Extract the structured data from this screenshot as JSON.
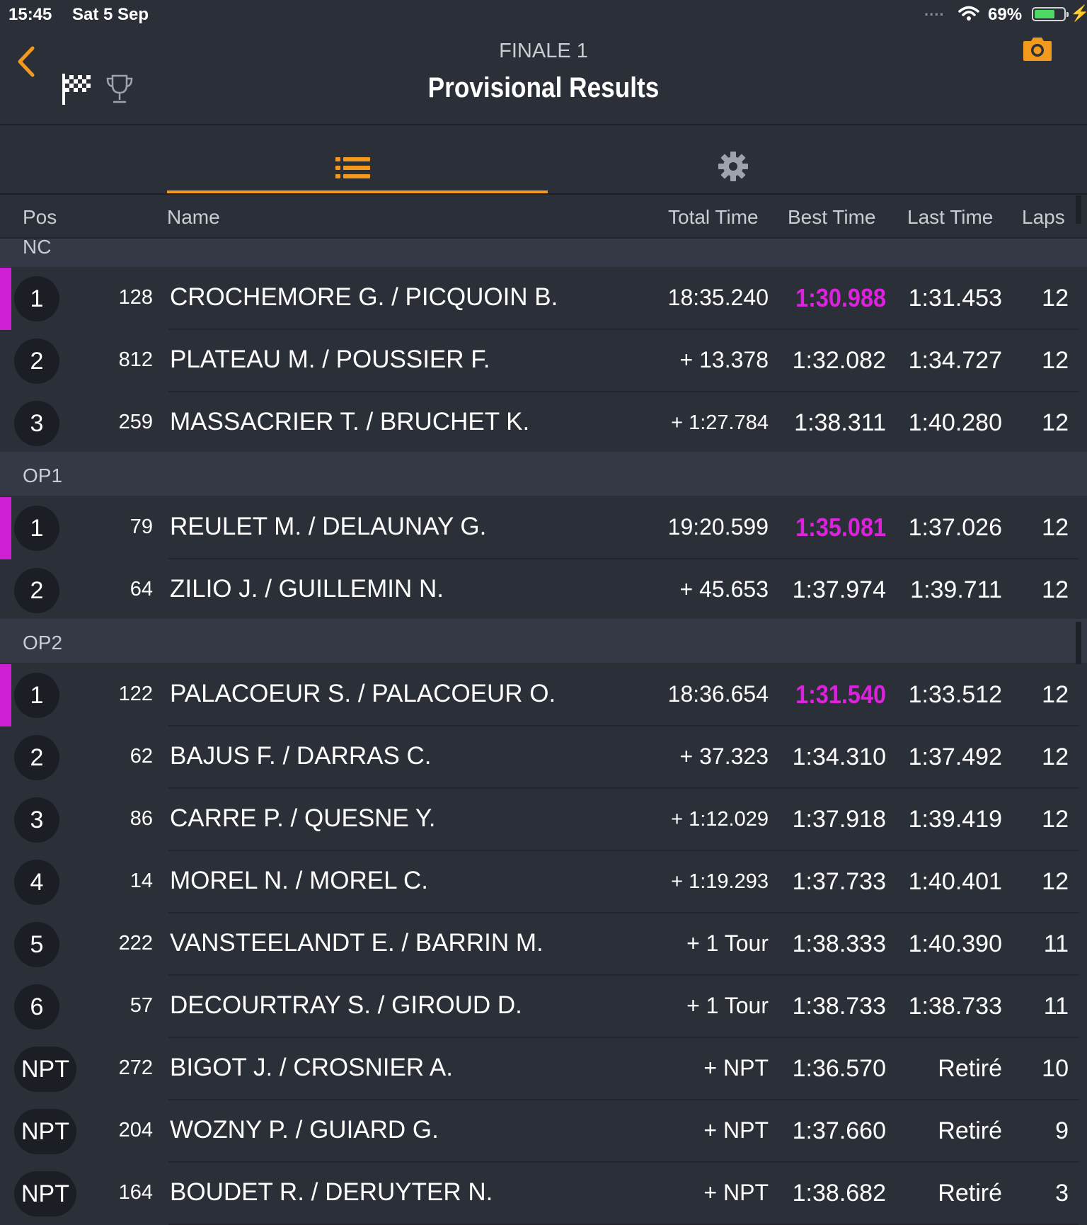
{
  "status_bar": {
    "time": "15:45",
    "date": "Sat 5 Sep",
    "signal_dots": "....",
    "battery_percent": "69%",
    "battery_level": 0.69
  },
  "header": {
    "subtitle": "FINALE 1",
    "title": "Provisional Results",
    "accent_color": "#f39a1e"
  },
  "columns": {
    "pos": "Pos",
    "name": "Name",
    "total": "Total Time",
    "best": "Best Time",
    "last": "Last Time",
    "laps": "Laps"
  },
  "groups": [
    {
      "label": "NC",
      "rows": [
        {
          "pos": "1",
          "num": "128",
          "name": "CROCHEMORE G. / PICQUOIN B.",
          "total": "18:35.240",
          "best": "1:30.988",
          "last": "1:31.453",
          "laps": "12",
          "winner": true
        },
        {
          "pos": "2",
          "num": "812",
          "name": "PLATEAU M. / POUSSIER F.",
          "total": "+ 13.378",
          "best": "1:32.082",
          "last": "1:34.727",
          "laps": "12"
        },
        {
          "pos": "3",
          "num": "259",
          "name": "MASSACRIER T. / BRUCHET K.",
          "total": "+ 1:27.784",
          "best": "1:38.311",
          "last": "1:40.280",
          "laps": "12"
        }
      ]
    },
    {
      "label": "OP1",
      "rows": [
        {
          "pos": "1",
          "num": "79",
          "name": "REULET M. / DELAUNAY G.",
          "total": "19:20.599",
          "best": "1:35.081",
          "last": "1:37.026",
          "laps": "12",
          "winner": true
        },
        {
          "pos": "2",
          "num": "64",
          "name": "ZILIO J. / GUILLEMIN N.",
          "total": "+ 45.653",
          "best": "1:37.974",
          "last": "1:39.711",
          "laps": "12"
        }
      ]
    },
    {
      "label": "OP2",
      "rows": [
        {
          "pos": "1",
          "num": "122",
          "name": "PALACOEUR S. / PALACOEUR O.",
          "total": "18:36.654",
          "best": "1:31.540",
          "last": "1:33.512",
          "laps": "12",
          "winner": true
        },
        {
          "pos": "2",
          "num": "62",
          "name": "BAJUS F. / DARRAS C.",
          "total": "+ 37.323",
          "best": "1:34.310",
          "last": "1:37.492",
          "laps": "12"
        },
        {
          "pos": "3",
          "num": "86",
          "name": "CARRE P. / QUESNE Y.",
          "total": "+ 1:12.029",
          "best": "1:37.918",
          "last": "1:39.419",
          "laps": "12"
        },
        {
          "pos": "4",
          "num": "14",
          "name": "MOREL N. / MOREL C.",
          "total": "+ 1:19.293",
          "best": "1:37.733",
          "last": "1:40.401",
          "laps": "12"
        },
        {
          "pos": "5",
          "num": "222",
          "name": "VANSTEELANDT E. / BARRIN M.",
          "total": "+ 1 Tour",
          "best": "1:38.333",
          "last": "1:40.390",
          "laps": "11"
        },
        {
          "pos": "6",
          "num": "57",
          "name": "DECOURTRAY S. / GIROUD D.",
          "total": "+ 1 Tour",
          "best": "1:38.733",
          "last": "1:38.733",
          "laps": "11"
        },
        {
          "pos": "NPT",
          "num": "272",
          "name": "BIGOT J. / CROSNIER A.",
          "total": "+ NPT",
          "best": "1:36.570",
          "last": "Retiré",
          "laps": "10"
        },
        {
          "pos": "NPT",
          "num": "204",
          "name": "WOZNY P. / GUIARD G.",
          "total": "+ NPT",
          "best": "1:37.660",
          "last": "Retiré",
          "laps": "9"
        },
        {
          "pos": "NPT",
          "num": "164",
          "name": "BOUDET R. / DERUYTER N.",
          "total": "+ NPT",
          "best": "1:38.682",
          "last": "Retiré",
          "laps": "3"
        }
      ]
    }
  ],
  "colors": {
    "background": "#2b2f38",
    "group_header": "#343945",
    "winner_highlight": "#cf1fd2",
    "fastest_lap": "#dd22dd",
    "accent": "#f39a1e"
  }
}
